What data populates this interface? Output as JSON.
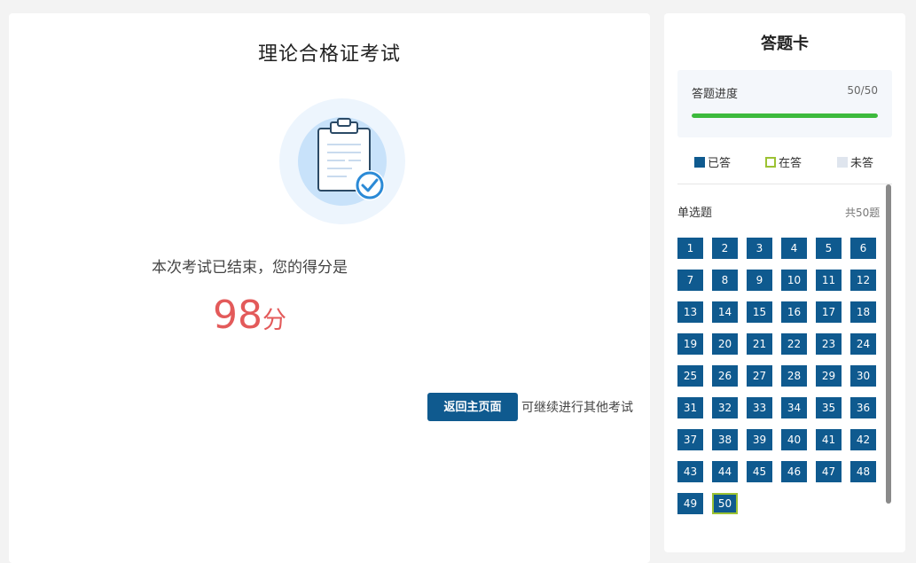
{
  "exam": {
    "title": "理论合格证考试",
    "end_text": "本次考试已结束，您的得分是",
    "score": "98",
    "score_unit": "分",
    "back_button": "返回主页面",
    "hint": "可继续进行其他考试",
    "illustration_icon": "clipboard-check-icon"
  },
  "answer_card": {
    "title": "答题卡",
    "progress_label": "答题进度",
    "progress_text": "50/50",
    "progress_fraction": 1.0,
    "legend": {
      "answered": "已答",
      "current": "在答",
      "unanswered": "未答"
    },
    "section_title": "单选题",
    "section_count": "共50题",
    "current_question": 50,
    "questions": [
      "1",
      "2",
      "3",
      "4",
      "5",
      "6",
      "7",
      "8",
      "9",
      "10",
      "11",
      "12",
      "13",
      "14",
      "15",
      "16",
      "17",
      "18",
      "19",
      "20",
      "21",
      "22",
      "23",
      "24",
      "25",
      "26",
      "27",
      "28",
      "29",
      "30",
      "31",
      "32",
      "33",
      "34",
      "35",
      "36",
      "37",
      "38",
      "39",
      "40",
      "41",
      "42",
      "43",
      "44",
      "45",
      "46",
      "47",
      "48",
      "49",
      "50"
    ]
  },
  "colors": {
    "primary": "#0f5a8f",
    "score": "#e35a5a",
    "progress": "#3cba3c",
    "current_border": "#9cc233",
    "unanswered": "#dfe5ee"
  }
}
